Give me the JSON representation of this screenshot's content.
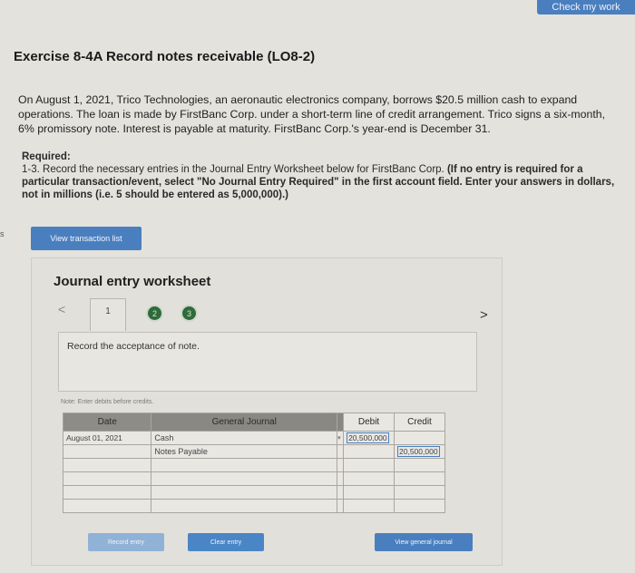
{
  "header": {
    "check_my_work": "Check my work"
  },
  "exercise": {
    "title": "Exercise 8-4A Record notes receivable (LO8-2)",
    "paragraph": "On August 1, 2021, Trico Technologies, an aeronautic electronics company, borrows $20.5 million cash to expand operations. The loan is made by FirstBanc Corp. under a short-term line of credit arrangement. Trico signs a six-month, 6% promissory note. Interest is payable at maturity. FirstBanc Corp.'s year-end is December 31.",
    "required_label": "Required:",
    "required_text": "1-3. Record the necessary entries in the Journal Entry Worksheet below for FirstBanc Corp.",
    "instruction": "(If no entry is required for a particular transaction/event, select \"No Journal Entry Required\" in the first account field. Enter your answers in dollars, not in millions (i.e. 5 should be entered as 5,000,000).)",
    "side_mark": "s"
  },
  "view_transaction_list": "View transaction list",
  "worksheet": {
    "title": "Journal entry worksheet",
    "prev": "<",
    "next": ">",
    "tabs": [
      "1",
      "2",
      "3"
    ],
    "description": "Record the acceptance of note.",
    "note": "Note: Enter debits before credits.",
    "columns": {
      "date": "Date",
      "journal": "General Journal",
      "debit": "Debit",
      "credit": "Credit"
    },
    "rows": [
      {
        "date": "August 01, 2021",
        "account": "Cash",
        "debit": "20,500,000",
        "credit": ""
      },
      {
        "date": "",
        "account": "Notes Payable",
        "debit": "",
        "credit": "20,500,000"
      },
      {
        "date": "",
        "account": "",
        "debit": "",
        "credit": ""
      },
      {
        "date": "",
        "account": "",
        "debit": "",
        "credit": ""
      },
      {
        "date": "",
        "account": "",
        "debit": "",
        "credit": ""
      },
      {
        "date": "",
        "account": "",
        "debit": "",
        "credit": ""
      }
    ],
    "buttons": {
      "record": "Record entry",
      "clear": "Clear entry",
      "view_journal": "View general journal"
    }
  },
  "colors": {
    "accent": "#4a7fbf",
    "tab_complete": "#2f6b3a",
    "background": "#e4e2dd"
  }
}
